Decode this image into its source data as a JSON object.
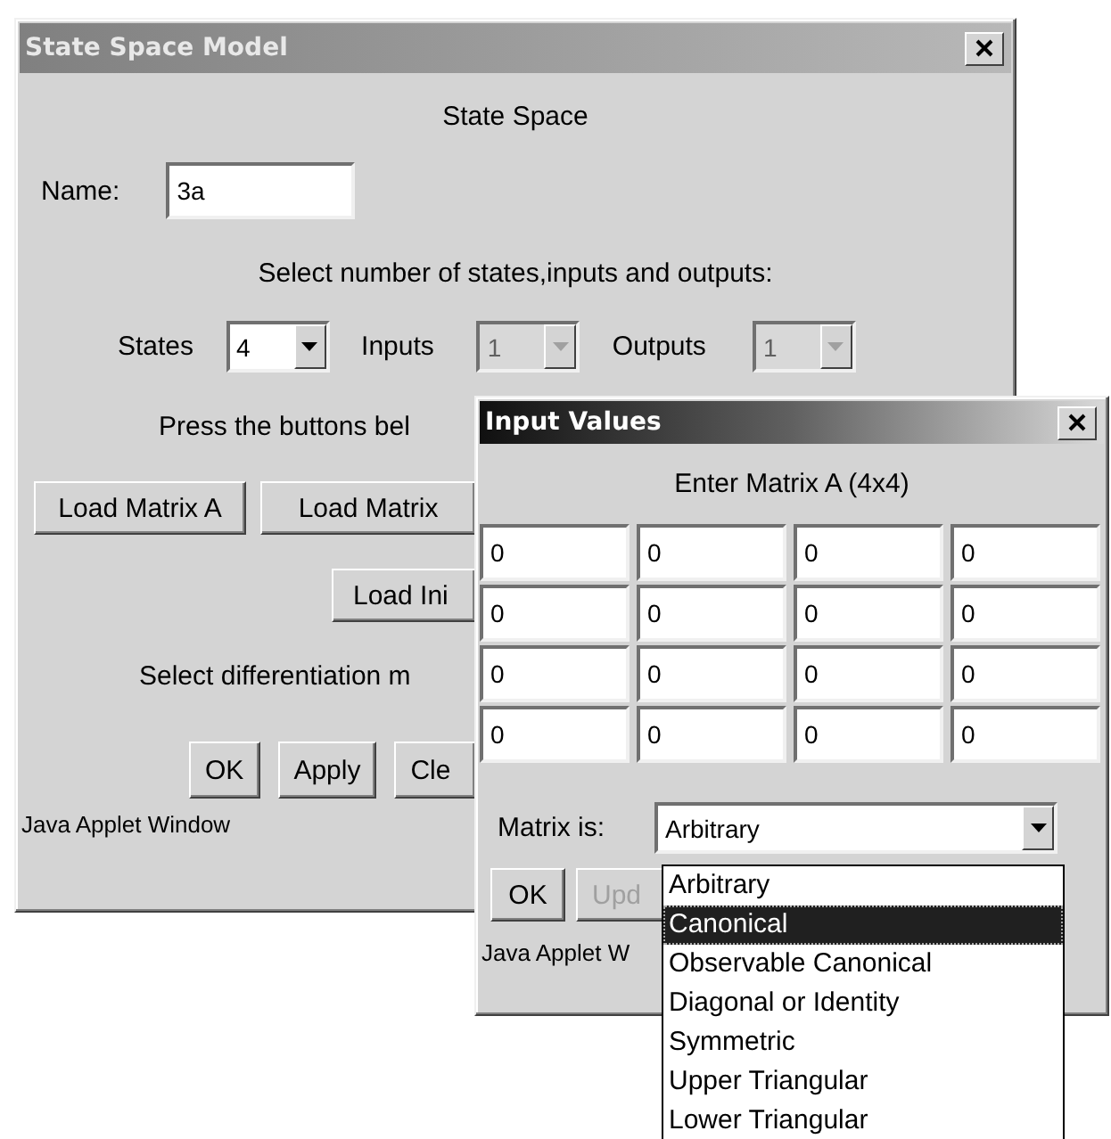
{
  "main_window": {
    "title": "State Space Model",
    "active": false,
    "heading": "State Space",
    "name_label": "Name:",
    "name_value": "3a",
    "count_prompt": "Select number of states,inputs and outputs:",
    "selectors": [
      {
        "label": "States",
        "value": "4",
        "disabled": false
      },
      {
        "label": "Inputs",
        "value": "1",
        "disabled": true
      },
      {
        "label": "Outputs",
        "value": "1",
        "disabled": true
      }
    ],
    "buttons_prompt": "Press the buttons bel",
    "load_buttons": [
      "Load Matrix A",
      "Load Matrix"
    ],
    "load_init_button": "Load Ini",
    "method_prompt": "Select differentiation m",
    "action_buttons": [
      "OK",
      "Apply",
      "Cle"
    ],
    "status": "Java Applet Window"
  },
  "dialog": {
    "title": "Input Values",
    "active": true,
    "heading": "Enter Matrix A (4x4)",
    "matrix": [
      [
        "0",
        "0",
        "0",
        "0"
      ],
      [
        "0",
        "0",
        "0",
        "0"
      ],
      [
        "0",
        "0",
        "0",
        "0"
      ],
      [
        "0",
        "0",
        "0",
        "0"
      ]
    ],
    "type_label": "Matrix is:",
    "type_value": "Arbitrary",
    "type_options": [
      {
        "label": "Arbitrary",
        "selected": false
      },
      {
        "label": "Canonical",
        "selected": true
      },
      {
        "label": "Observable Canonical",
        "selected": false
      },
      {
        "label": "Diagonal or Identity",
        "selected": false
      },
      {
        "label": "Symmetric",
        "selected": false
      },
      {
        "label": "Upper Triangular",
        "selected": false
      },
      {
        "label": "Lower Triangular",
        "selected": false
      }
    ],
    "buttons": [
      {
        "label": "OK",
        "disabled": false
      },
      {
        "label": "Upd",
        "disabled": true
      }
    ],
    "status": "Java Applet W"
  }
}
